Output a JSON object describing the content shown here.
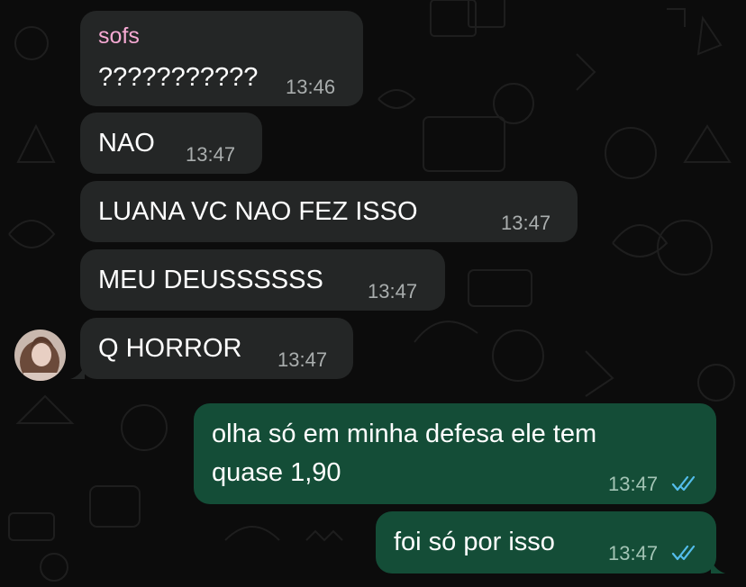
{
  "chat": {
    "messages": [
      {
        "id": 1,
        "direction": "incoming",
        "sender": "sofs",
        "text": "???????????",
        "time": "13:46"
      },
      {
        "id": 2,
        "direction": "incoming",
        "text": "NAO",
        "time": "13:47"
      },
      {
        "id": 3,
        "direction": "incoming",
        "text": "LUANA VC NAO FEZ ISSO",
        "time": "13:47"
      },
      {
        "id": 4,
        "direction": "incoming",
        "text": "MEU DEUSSSSSS",
        "time": "13:47"
      },
      {
        "id": 5,
        "direction": "incoming",
        "text": "Q HORROR",
        "time": "13:47"
      },
      {
        "id": 6,
        "direction": "outgoing",
        "text_lines": [
          "olha só em minha defesa ele tem",
          "quase 1,90"
        ],
        "time": "13:47",
        "status": "read"
      },
      {
        "id": 7,
        "direction": "outgoing",
        "text": "foi só por isso",
        "time": "13:47",
        "status": "read"
      }
    ]
  },
  "icons": {
    "read_receipt": "double-check-icon",
    "avatar": "contact-avatar"
  },
  "colors": {
    "background": "#0c0c0c",
    "incoming_bubble": "#242626",
    "outgoing_bubble": "#144d37",
    "sender_name": "#f6a9d3",
    "read_ticks": "#53bdeb"
  }
}
